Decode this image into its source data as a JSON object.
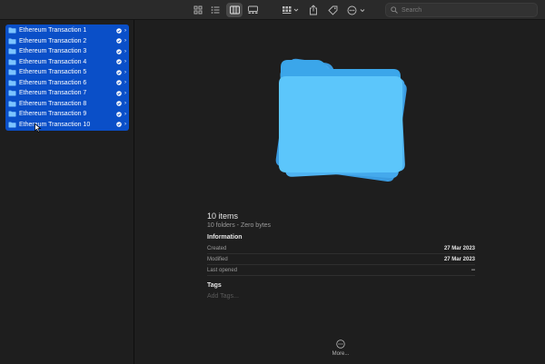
{
  "toolbar": {
    "search_placeholder": "Search",
    "views": [
      "icon-view",
      "list-view",
      "column-view",
      "gallery-view"
    ],
    "active_view": "column-view"
  },
  "sidebar": {
    "items": [
      {
        "label": "Ethereum Transaction 1"
      },
      {
        "label": "Ethereum Transaction 2"
      },
      {
        "label": "Ethereum Transaction 3"
      },
      {
        "label": "Ethereum Transaction 4"
      },
      {
        "label": "Ethereum Transaction 5"
      },
      {
        "label": "Ethereum Transaction 6"
      },
      {
        "label": "Ethereum Transaction 7"
      },
      {
        "label": "Ethereum Transaction 8"
      },
      {
        "label": "Ethereum Transaction 9"
      },
      {
        "label": "Ethereum Transaction 10"
      }
    ]
  },
  "preview": {
    "title": "10 items",
    "subtitle": "10 folders - Zero bytes",
    "information_heading": "Information",
    "info": [
      {
        "key": "Created",
        "value": "27 Mar 2023"
      },
      {
        "key": "Modified",
        "value": "27 Mar 2023"
      },
      {
        "key": "Last opened",
        "value": "--"
      }
    ],
    "tags_heading": "Tags",
    "tags_placeholder": "Add Tags...",
    "more_label": "More..."
  },
  "colors": {
    "selection": "#0a4fc8",
    "folder": "#5ac8fa",
    "background": "#1e1e1e"
  }
}
